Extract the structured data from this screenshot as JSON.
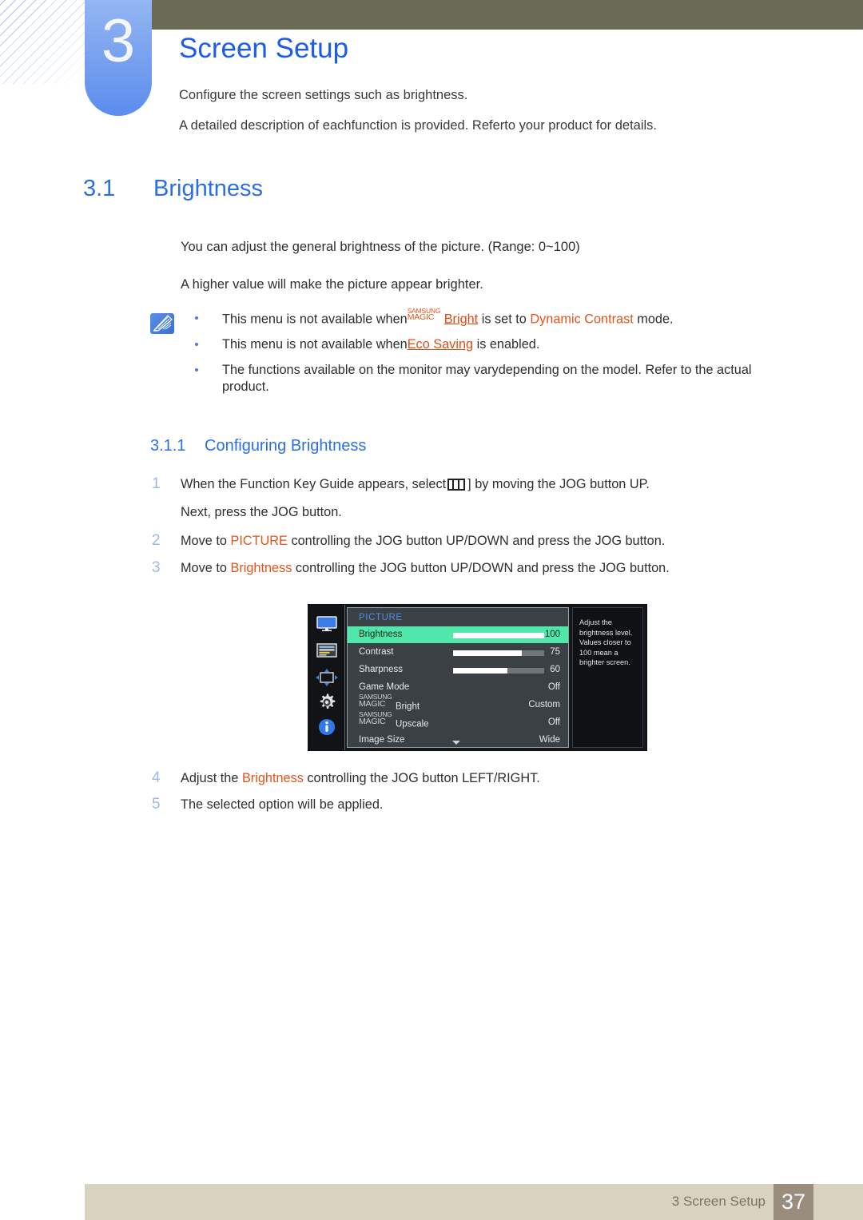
{
  "chapter": {
    "number": "3",
    "title": "Screen Setup",
    "lead_1": "Configure the screen settings such as brightness.",
    "lead_2": "A detailed description of eachfunction is provided. Referto your product for details."
  },
  "section": {
    "number": "3.1",
    "title": "Brightness",
    "para_1": "You can adjust the general brightness of the picture. (Range: 0~100)",
    "para_2": "A higher value will make the picture appear brighter."
  },
  "note": {
    "icon": "note-pen-icon",
    "items": [
      {
        "prefix": "This menu is not available when",
        "magic_top": "SAMSUNG",
        "magic_bottom": "MAGIC",
        "link_1": "Bright",
        "middle": " is set to ",
        "link_2": "Dynamic Contrast",
        "suffix": " mode."
      },
      {
        "prefix": "This menu is not available when",
        "link_1": "Eco Saving",
        "suffix": " is enabled."
      },
      {
        "text": "The functions available on the monitor may varydepending on the model. Refer to the actual product."
      }
    ]
  },
  "subsection": {
    "number": "3.1.1",
    "title": "Configuring Brightness"
  },
  "steps": [
    {
      "n": "1",
      "before_glyph": "When the Function Key Guide appears, select",
      "glyph": "picture-menu-glyph",
      "after_glyph": "] by moving the JOG button UP.",
      "continuation": "Next, press the JOG button."
    },
    {
      "n": "2",
      "before": "Move to ",
      "highlight": "PICTURE",
      "after": " controlling the JOG button UP/DOWN and press the JOG button."
    },
    {
      "n": "3",
      "before": "Move to ",
      "highlight": "Brightness",
      "after": " controlling the JOG button UP/DOWN and press the JOG button."
    },
    {
      "n": "4",
      "before": "Adjust the ",
      "highlight": "Brightness",
      "after": " controlling the JOG button LEFT/RIGHT."
    },
    {
      "n": "5",
      "before": "The selected option will be applied.",
      "highlight": "",
      "after": ""
    }
  ],
  "osd": {
    "title": "PICTURE",
    "rail_icons": [
      "monitor-picture-icon",
      "onscreen-display-icon",
      "system-adjust-icon",
      "setup-gear-icon",
      "information-icon"
    ],
    "rows": [
      {
        "label": "Brightness",
        "value": "100",
        "bar": 100,
        "selected": true
      },
      {
        "label": "Contrast",
        "value": "75",
        "bar": 75,
        "selected": false
      },
      {
        "label": "Sharpness",
        "value": "60",
        "bar": 60,
        "selected": false
      },
      {
        "label": "Game Mode",
        "value": "Off",
        "bar": null,
        "selected": false
      },
      {
        "label": "Bright",
        "value": "Custom",
        "bar": null,
        "selected": false,
        "magic_top": "SAMSUNG",
        "magic_bottom": "MAGIC"
      },
      {
        "label": "Upscale",
        "value": "Off",
        "bar": null,
        "selected": false,
        "magic_top": "SAMSUNG",
        "magic_bottom": "MAGIC"
      },
      {
        "label": "Image Size",
        "value": "Wide",
        "bar": null,
        "selected": false
      }
    ],
    "help_text": "Adjust the brightness level. Values closer to 100 mean a brighter screen.",
    "scroll_arrow": "chevron-down-icon"
  },
  "footer": {
    "label": "3 Screen Setup",
    "page": "37"
  },
  "colors": {
    "heading_blue": "#2b6fe8",
    "title_blue": "#1b5cf0",
    "link_orange": "#e2541b",
    "olive_bar": "#6b6a55",
    "footer_bar": "#d8d3c0",
    "footer_page": "#9a8d7e",
    "osd_highlight": "#4fe8aa"
  }
}
